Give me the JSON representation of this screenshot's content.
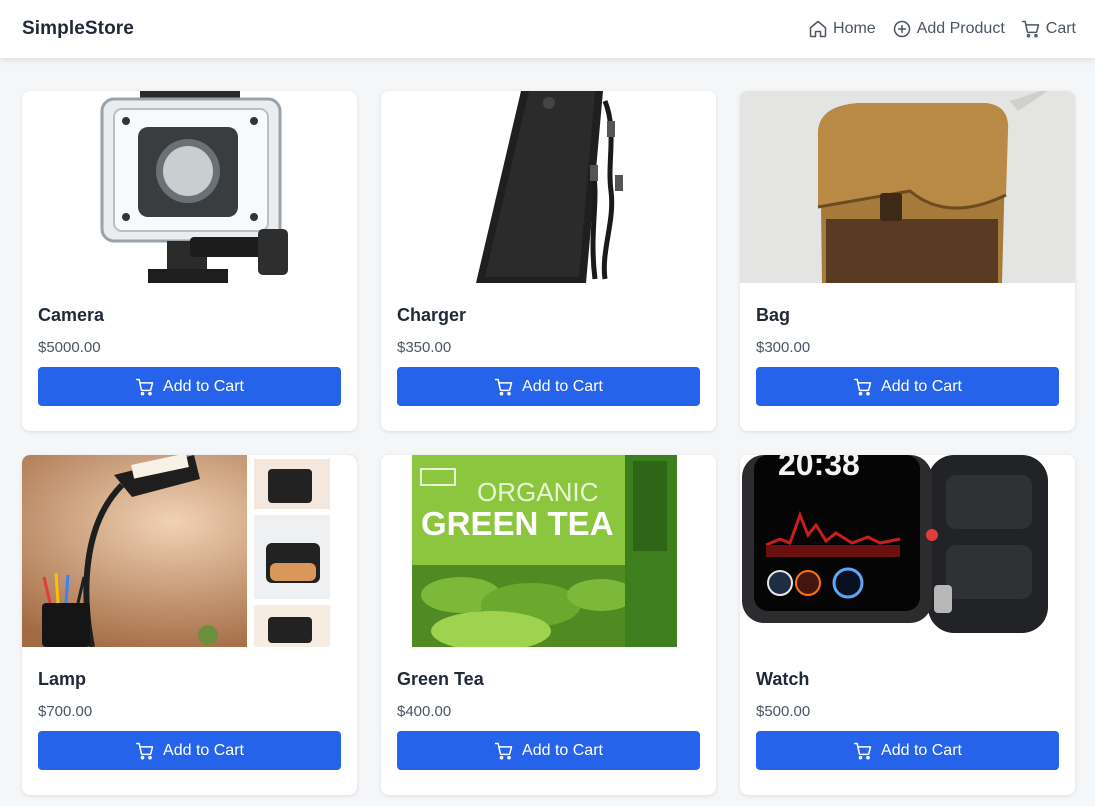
{
  "app": {
    "brand": "SimpleStore"
  },
  "nav": {
    "items": [
      {
        "label": "Home",
        "icon": "home-icon"
      },
      {
        "label": "Add Product",
        "icon": "plus-circle-icon"
      },
      {
        "label": "Cart",
        "icon": "cart-icon"
      }
    ]
  },
  "theme": {
    "accent": "#2563eb",
    "background": "#f5f6f8"
  },
  "products": [
    {
      "name": "Camera",
      "price": "$5000.00",
      "button": "Add to Cart",
      "image": "camera-image"
    },
    {
      "name": "Charger",
      "price": "$350.00",
      "button": "Add to Cart",
      "image": "charger-image"
    },
    {
      "name": "Bag",
      "price": "$300.00",
      "button": "Add to Cart",
      "image": "bag-image"
    },
    {
      "name": "Lamp",
      "price": "$700.00",
      "button": "Add to Cart",
      "image": "lamp-image"
    },
    {
      "name": "Green Tea",
      "price": "$400.00",
      "button": "Add to Cart",
      "image": "green-tea-image"
    },
    {
      "name": "Watch",
      "price": "$500.00",
      "button": "Add to Cart",
      "image": "watch-image"
    }
  ],
  "images": {
    "tea_lines": [
      "ORGANIC",
      "GREEN TEA"
    ],
    "watch_time": "20:38"
  }
}
